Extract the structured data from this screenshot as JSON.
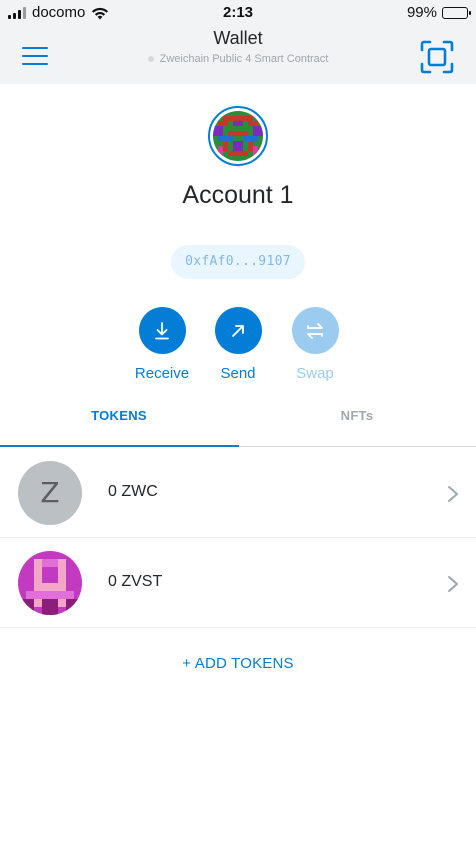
{
  "status_bar": {
    "carrier": "docomo",
    "time": "2:13",
    "battery": "99%",
    "battery_level": 0.99,
    "signal_bars": 3,
    "icons": [
      "signal-icon",
      "wifi-icon",
      "battery-icon"
    ]
  },
  "header": {
    "title": "Wallet",
    "network": "Zweichain Public 4 Smart Contract",
    "menu_icon": "hamburger-menu-icon",
    "scan_icon": "qr-scan-icon"
  },
  "account": {
    "name": "Account 1",
    "address": "0xfAf0...9107",
    "avatar_icon": "identicon-avatar"
  },
  "actions": [
    {
      "label": "Receive",
      "icon": "download-arrow-icon",
      "enabled": true
    },
    {
      "label": "Send",
      "icon": "diagonal-arrow-icon",
      "enabled": true
    },
    {
      "label": "Swap",
      "icon": "swap-arrows-icon",
      "enabled": false
    }
  ],
  "tabs": [
    {
      "label": "TOKENS",
      "active": true
    },
    {
      "label": "NFTs",
      "active": false
    }
  ],
  "tokens": [
    {
      "icon_letter": "Z",
      "amount": "0 ZWC",
      "icon": "letter-avatar"
    },
    {
      "amount": "0 ZVST",
      "icon": "pixel-identicon"
    }
  ],
  "add_tokens_label": "+ ADD TOKENS",
  "colors": {
    "accent": "#037dd6",
    "accent_disabled": "#9bccf0",
    "text": "#24272a",
    "muted": "#9fa6ae",
    "header_bg": "#f2f3f4",
    "address_bg": "#eaf6ff"
  }
}
